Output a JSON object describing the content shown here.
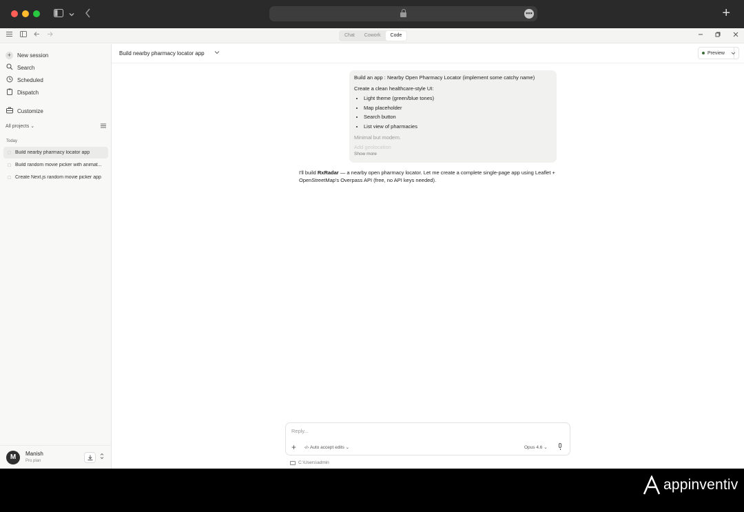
{
  "browser": {
    "more_glyph": "•••",
    "newtab_glyph": "+"
  },
  "modes": [
    "Chat",
    "Cowork",
    "Code"
  ],
  "active_mode": "Code",
  "sidebar": {
    "new_session": "New session",
    "search": "Search",
    "scheduled": "Scheduled",
    "dispatch": "Dispatch",
    "customize": "Customize",
    "projects_filter": "All projects",
    "section_today": "Today",
    "sessions": [
      "Build nearby pharmacy locator app",
      "Build random movie picker with animat...",
      "Create Next.js random movie picker app"
    ]
  },
  "user": {
    "initial": "M",
    "name": "Manish",
    "plan": "Pro plan"
  },
  "header": {
    "session_title": "Build nearby pharmacy locator app",
    "preview_label": "Preview"
  },
  "user_message": {
    "line1": "Build an app : Nearby Open Pharmacy Locator (implement some catchy name)",
    "line2": "Create a clean healthcare-style UI:",
    "bullets": [
      "Light theme (green/blue tones)",
      "Map placeholder",
      "Search button",
      "List view of pharmacies"
    ],
    "line3": "Minimal but modern.",
    "line4": "Add geolocation",
    "show_more": "Show more"
  },
  "assistant": {
    "prefix": "I'll build ",
    "name": "RxRadar",
    "suffix": " — a nearby open pharmacy locator. Let me create a complete single-page app using Leaflet + OpenStreetMap's Overpass API (free, no API keys needed)."
  },
  "composer": {
    "placeholder": "Reply...",
    "auto_accept": "Auto accept edits",
    "model": "Opus 4.6",
    "path": "C:\\Users\\admin"
  },
  "brand": {
    "name": "appinventiv"
  },
  "colors": {
    "accent_green": "#3c6b3a",
    "traffic_red": "#ff5f57",
    "traffic_yellow": "#febc2e",
    "traffic_green": "#28c840"
  }
}
